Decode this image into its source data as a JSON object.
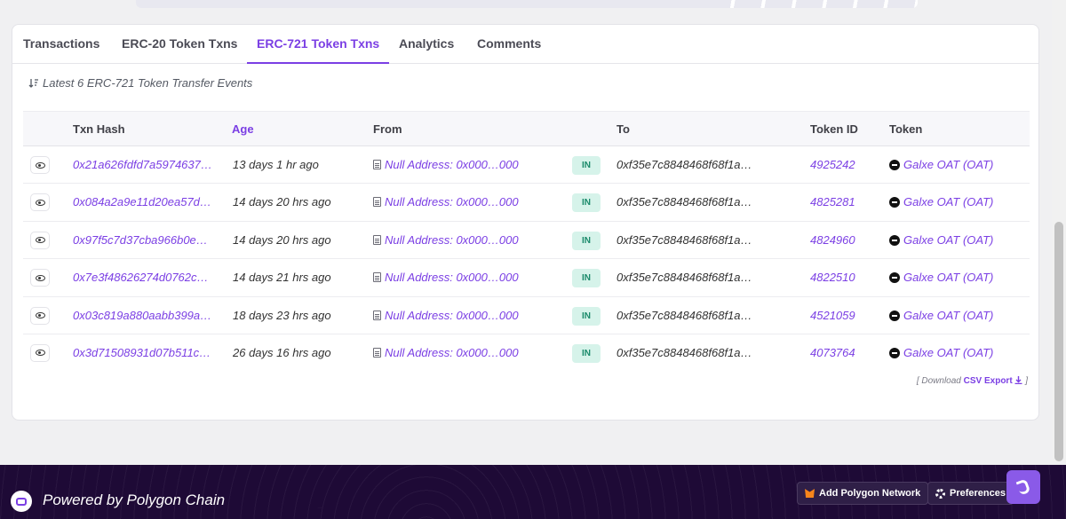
{
  "tabs": [
    {
      "label": "Transactions"
    },
    {
      "label": "ERC-20 Token Txns"
    },
    {
      "label": "ERC-721 Token Txns"
    },
    {
      "label": "Analytics"
    },
    {
      "label": "Comments"
    }
  ],
  "active_tab": "ERC-721 Token Txns",
  "subtitle": "Latest 6 ERC-721 Token Transfer Events",
  "columns": {
    "txn_hash": "Txn Hash",
    "age": "Age",
    "from": "From",
    "to": "To",
    "token_id": "Token ID",
    "token": "Token"
  },
  "rows": [
    {
      "hash": "0x21a626fdfd7a5974637…",
      "age": "13 days 1 hr ago",
      "from": "Null Address: 0x000…000",
      "direction": "IN",
      "to": "0xf35e7c8848468f68f1a…",
      "token_id": "4925242",
      "token": "Galxe OAT (OAT)"
    },
    {
      "hash": "0x084a2a9e11d20ea57d…",
      "age": "14 days 20 hrs ago",
      "from": "Null Address: 0x000…000",
      "direction": "IN",
      "to": "0xf35e7c8848468f68f1a…",
      "token_id": "4825281",
      "token": "Galxe OAT (OAT)"
    },
    {
      "hash": "0x97f5c7d37cba966b0e…",
      "age": "14 days 20 hrs ago",
      "from": "Null Address: 0x000…000",
      "direction": "IN",
      "to": "0xf35e7c8848468f68f1a…",
      "token_id": "4824960",
      "token": "Galxe OAT (OAT)"
    },
    {
      "hash": "0x7e3f48626274d0762c…",
      "age": "14 days 21 hrs ago",
      "from": "Null Address: 0x000…000",
      "direction": "IN",
      "to": "0xf35e7c8848468f68f1a…",
      "token_id": "4822510",
      "token": "Galxe OAT (OAT)"
    },
    {
      "hash": "0x03c819a880aabb399a…",
      "age": "18 days 23 hrs ago",
      "from": "Null Address: 0x000…000",
      "direction": "IN",
      "to": "0xf35e7c8848468f68f1a…",
      "token_id": "4521059",
      "token": "Galxe OAT (OAT)"
    },
    {
      "hash": "0x3d71508931d07b511c…",
      "age": "26 days 16 hrs ago",
      "from": "Null Address: 0x000…000",
      "direction": "IN",
      "to": "0xf35e7c8848468f68f1a…",
      "token_id": "4073764",
      "token": "Galxe OAT (OAT)"
    }
  ],
  "download": {
    "prefix": "[ Download",
    "link": "CSV Export",
    "suffix": "]"
  },
  "footer": {
    "powered_by": "Powered by Polygon Chain",
    "add_network": "Add Polygon Network",
    "preferences": "Preferences"
  },
  "colors": {
    "accent": "#7b3fe4",
    "footer_bg": "#1e0a36",
    "in_badge_bg": "#d6f3ea"
  }
}
